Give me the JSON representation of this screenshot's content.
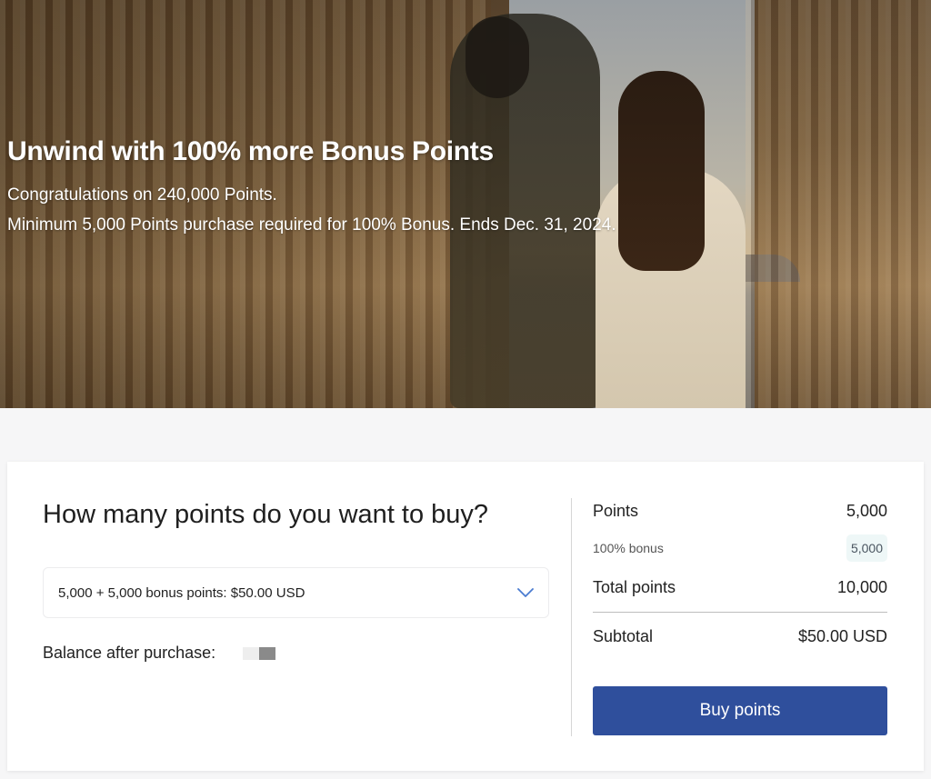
{
  "hero": {
    "title": "Unwind with 100% more Bonus Points",
    "line1": "Congratulations on 240,000 Points.",
    "line2": "Minimum 5,000 Points purchase required for 100% Bonus. Ends Dec. 31, 2024."
  },
  "purchase": {
    "question": "How many points do you want to buy?",
    "select_value": "5,000 + 5,000 bonus points: $50.00 USD",
    "balance_label": "Balance after purchase:"
  },
  "summary": {
    "points_label": "Points",
    "points_value": "5,000",
    "bonus_label": "100% bonus",
    "bonus_value": "5,000",
    "total_label": "Total points",
    "total_value": "10,000",
    "subtotal_label": "Subtotal",
    "subtotal_value": "$50.00 USD",
    "buy_button": "Buy points"
  },
  "colors": {
    "button": "#2f4f9c",
    "chevron": "#4a7bd0",
    "bonus_badge_bg": "#eef7f7"
  },
  "icons": {
    "select_chevron": "chevron-down-icon"
  }
}
